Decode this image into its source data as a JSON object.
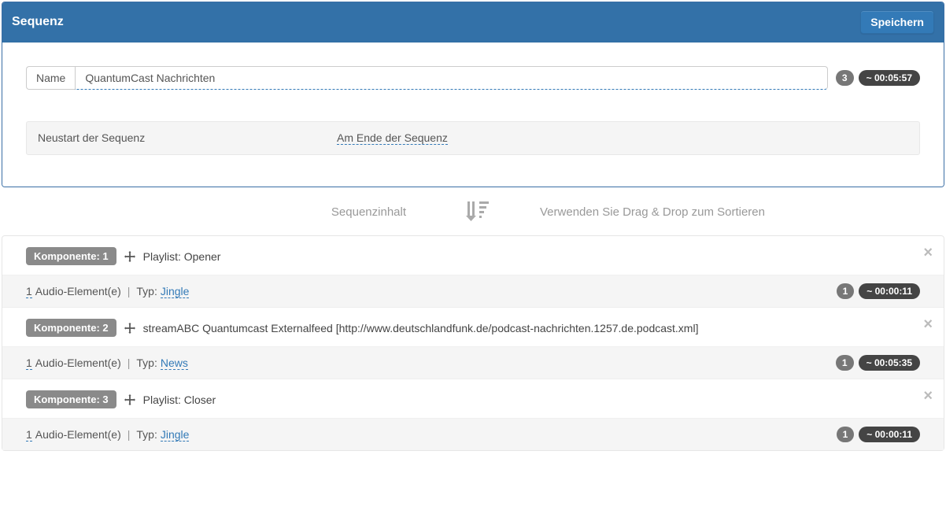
{
  "header": {
    "title": "Sequenz",
    "save_label": "Speichern"
  },
  "name_field": {
    "label": "Name",
    "value": "QuantumCast Nachrichten"
  },
  "summary": {
    "count": "3",
    "duration": "~ 00:05:57"
  },
  "restart": {
    "label": "Neustart der Sequenz",
    "value": "Am Ende der Sequenz"
  },
  "section": {
    "content_label": "Sequenzinhalt",
    "hint": "Verwenden Sie Drag & Drop zum Sortieren"
  },
  "components": [
    {
      "badge": "Komponente: 1",
      "title": "Playlist: Opener",
      "audio_count": "1",
      "audio_text": " Audio-Element(e) ",
      "type_label": "Typ: ",
      "type_value": "Jingle",
      "count_badge": "1",
      "duration": "~ 00:00:11"
    },
    {
      "badge": "Komponente: 2",
      "title": "streamABC Quantumcast Externalfeed [http://www.deutschlandfunk.de/podcast-nachrichten.1257.de.podcast.xml]",
      "audio_count": "1",
      "audio_text": " Audio-Element(e) ",
      "type_label": "Typ: ",
      "type_value": "News",
      "count_badge": "1",
      "duration": "~ 00:05:35"
    },
    {
      "badge": "Komponente: 3",
      "title": "Playlist: Closer",
      "audio_count": "1",
      "audio_text": " Audio-Element(e) ",
      "type_label": "Typ: ",
      "type_value": "Jingle",
      "count_badge": "1",
      "duration": "~ 00:00:11"
    }
  ],
  "pipe": "|"
}
